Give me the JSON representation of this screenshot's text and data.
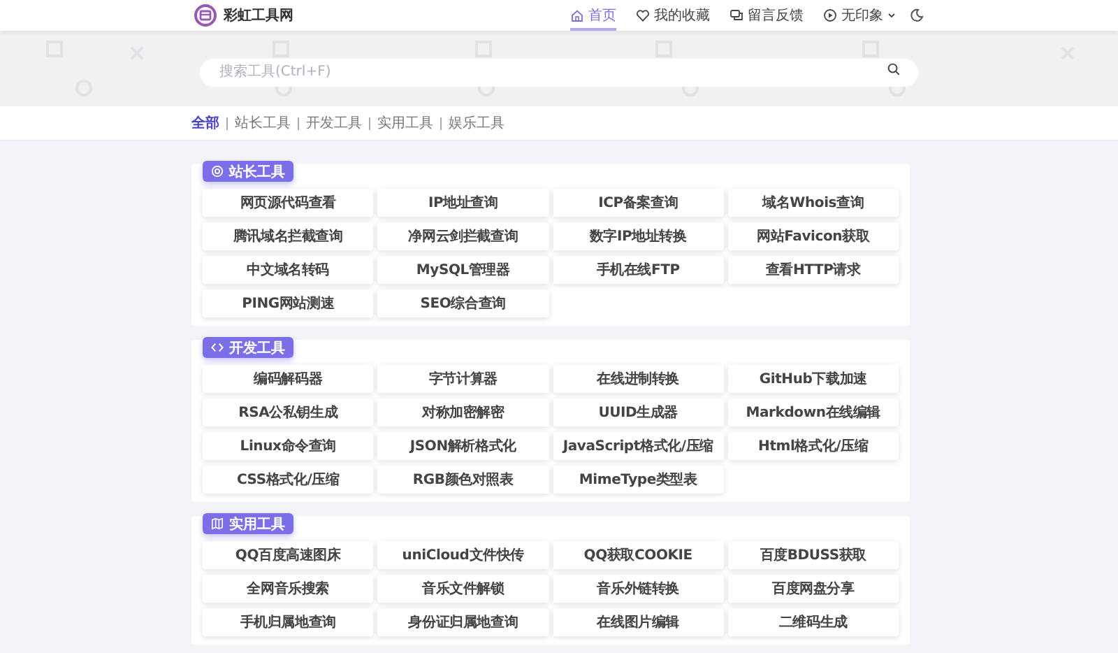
{
  "header": {
    "logo": "彩虹工具网",
    "nav": [
      {
        "label": "首页",
        "kind": "home",
        "selected": true
      },
      {
        "label": "我的收藏",
        "kind": "heart",
        "selected": false
      },
      {
        "label": "留言反馈",
        "kind": "chat",
        "selected": false
      },
      {
        "label": "无印象",
        "kind": "user",
        "selected": false,
        "dropdown": true
      }
    ]
  },
  "search": {
    "placeholder": "搜索工具(Ctrl+F)"
  },
  "breadcrumb": [
    {
      "label": "全部",
      "selected": true
    },
    {
      "label": "站长工具",
      "selected": false
    },
    {
      "label": "开发工具",
      "selected": false
    },
    {
      "label": "实用工具",
      "selected": false
    },
    {
      "label": "娱乐工具",
      "selected": false
    }
  ],
  "sections": [
    {
      "title": "站长工具",
      "kind": "target",
      "tools": [
        "网页源代码查看",
        "IP地址查询",
        "ICP备案查询",
        "域名Whois查询",
        "腾讯域名拦截查询",
        "净网云剑拦截查询",
        "数字IP地址转换",
        "网站Favicon获取",
        "中文域名转码",
        "MySQL管理器",
        "手机在线FTP",
        "查看HTTP请求",
        "PING网站测速",
        "SEO综合查询"
      ]
    },
    {
      "title": "开发工具",
      "kind": "code",
      "tools": [
        "编码解码器",
        "字节计算器",
        "在线进制转换",
        "GitHub下载加速",
        "RSA公私钥生成",
        "对称加密解密",
        "UUID生成器",
        "Markdown在线编辑",
        "Linux命令查询",
        "JSON解析格式化",
        "JavaScript格式化/压缩",
        "Html格式化/压缩",
        "CSS格式化/压缩",
        "RGB颜色对照表",
        "MimeType类型表"
      ]
    },
    {
      "title": "实用工具",
      "kind": "map",
      "tools": [
        "QQ百度高速图床",
        "uniCloud文件快传",
        "QQ获取COOKIE",
        "百度BDUSS获取",
        "全网音乐搜索",
        "音乐文件解锁",
        "音乐外链转换",
        "百度网盘分享",
        "手机归属地查询",
        "身份证归属地查询",
        "在线图片编辑",
        "二维码生成"
      ]
    }
  ]
}
